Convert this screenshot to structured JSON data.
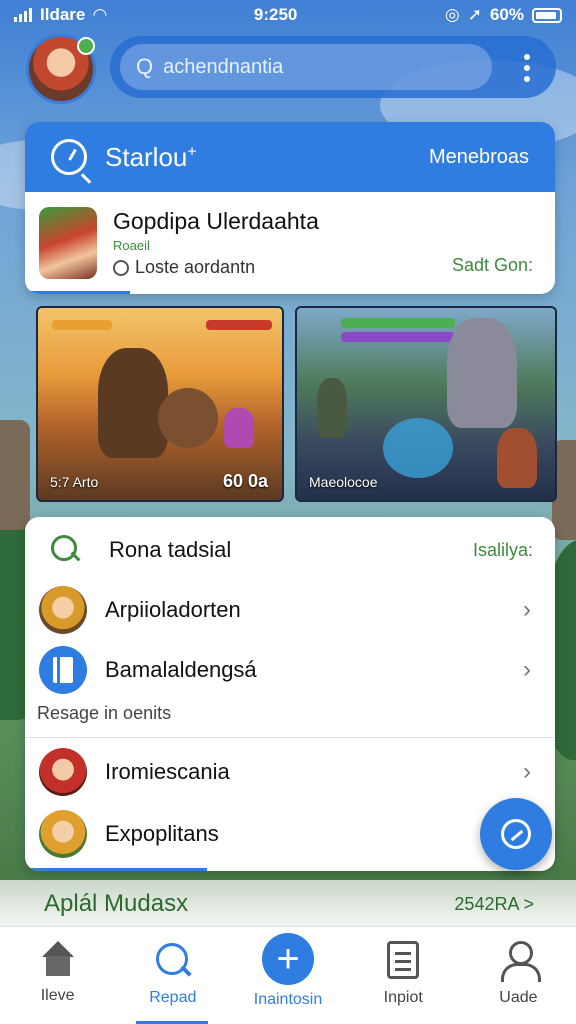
{
  "status_bar": {
    "carrier": "Ildare",
    "time": "9:250",
    "battery": "60%"
  },
  "search": {
    "placeholder": "achendnantia"
  },
  "featured": {
    "title": "Starlou",
    "title_mark": "+",
    "link": "Menebroas",
    "game": {
      "name": "Gopdipa Ulerdaahta",
      "tag": "Roaeil",
      "status": "Loste aordantn",
      "action": "Sadt Gon:"
    }
  },
  "screenshots": [
    {
      "caption_left": "5:7 Arto",
      "caption_right": "60 0a"
    },
    {
      "caption_left": "Maeolocoe"
    }
  ],
  "list": {
    "search_row": {
      "label": "Rona tadsial",
      "right": "Isalilya:"
    },
    "items": [
      {
        "label": "Arpiioladorten"
      },
      {
        "label": "Bamalaldengsá"
      }
    ],
    "section_note": "Resage in oenits",
    "items2": [
      {
        "label": "Iromiescania"
      },
      {
        "label": "Expoplitans"
      }
    ]
  },
  "bottom_strip": {
    "left": "Aplál Mudasx",
    "right": "2542RA >"
  },
  "nav": [
    {
      "label": "Ileve",
      "icon": "home-icon"
    },
    {
      "label": "Repad",
      "icon": "search-icon"
    },
    {
      "label": "Inaintosin",
      "icon": "plus-icon"
    },
    {
      "label": "Inpiot",
      "icon": "document-icon"
    },
    {
      "label": "Uade",
      "icon": "user-icon"
    }
  ],
  "colors": {
    "accent": "#2f7de1",
    "green": "#3d8b3d"
  }
}
